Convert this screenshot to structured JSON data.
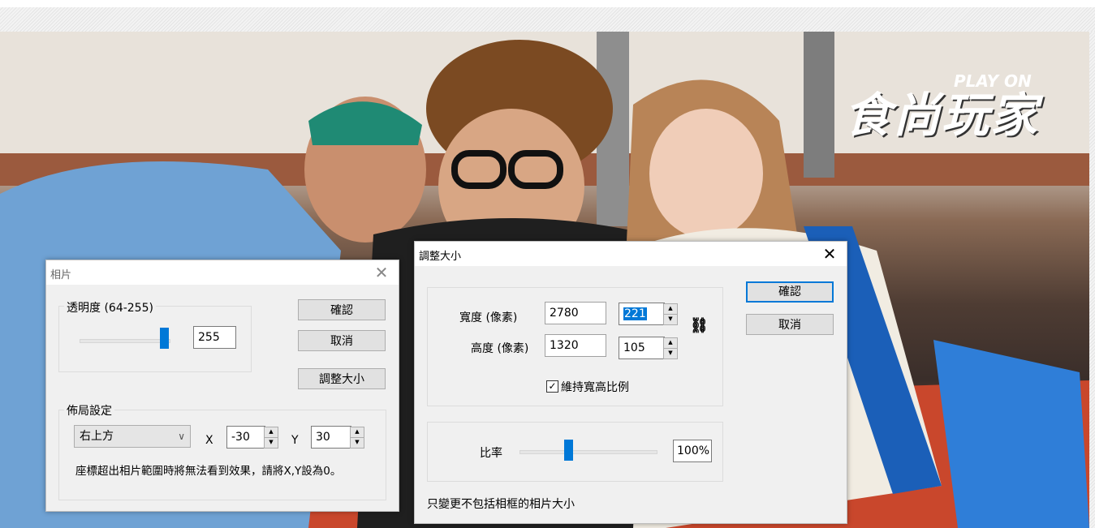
{
  "background": {
    "logo_main": "食尚玩家",
    "logo_sub": "PLAY ON"
  },
  "photo_dialog": {
    "title": "相片",
    "opacity_group_label": "透明度 (64-255)",
    "opacity_value": "255",
    "opacity_level_fraction": 0.9,
    "ok_label": "確認",
    "cancel_label": "取消",
    "resize_label": "調整大小",
    "layout_group_label": "佈局設定",
    "position_select": "右上方",
    "x_label": "X",
    "x_value": "-30",
    "y_label": "Y",
    "y_value": "30",
    "hint": "座標超出相片範圍時將無法看到效果，請將X,Y設為0。"
  },
  "resize_dialog": {
    "title": "調整大小",
    "width_label": "寬度 (像素)",
    "width_original": "2780",
    "width_value": "221",
    "height_label": "高度 (像素)",
    "height_original": "1320",
    "height_value": "105",
    "keep_ratio_label": "維持寬高比例",
    "keep_ratio_checked": true,
    "ratio_label": "比率",
    "ratio_value": "100%",
    "ratio_level_fraction": 0.33,
    "ok_label": "確認",
    "cancel_label": "取消",
    "footer_note": "只變更不包括相框的相片大小"
  },
  "colors": {
    "accent": "#0078d7",
    "dialog_bg": "#f0f0f0"
  }
}
